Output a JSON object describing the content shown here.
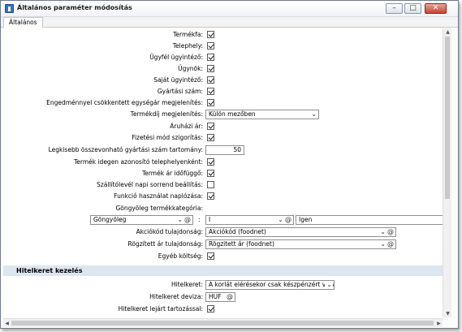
{
  "window": {
    "title": "Általános paraméter módosítás"
  },
  "tabs": [
    {
      "label": "Általános"
    }
  ],
  "params": {
    "termekfa": {
      "label": "Termékfa:",
      "checked": true
    },
    "telephely": {
      "label": "Telephely:",
      "checked": true
    },
    "ugyfel_ugyintezo": {
      "label": "Ügyfél ügyintéző:",
      "checked": true
    },
    "ugynok": {
      "label": "Ügynök:",
      "checked": true
    },
    "sajat_ugyintezo": {
      "label": "Saját ügyintéző:",
      "checked": true
    },
    "gyartasi_szam": {
      "label": "Gyártási szám:",
      "checked": true
    },
    "engedmeny": {
      "label": "Engedménnyel csökkentett egységár megjelenítés:",
      "checked": true
    },
    "termekdij": {
      "label": "Termékdíj megjelenítés:",
      "value": "Külön mezőben"
    },
    "aruhazi_ar": {
      "label": "Áruházi ár:",
      "checked": true
    },
    "fizetesi_mod": {
      "label": "Fizetési mód szigorítás:",
      "checked": true
    },
    "gyartasi_tartomany": {
      "label": "Legkisebb összevonható gyártási szám tartomány:",
      "value": "50"
    },
    "idegen_azonosito": {
      "label": "Termék idegen azonosító telephelyenként:",
      "checked": true
    },
    "ar_idofuggo": {
      "label": "Termék ár időfüggő:",
      "checked": true
    },
    "szallitolevel": {
      "label": "Szállítólevél napi sorrend beállítás:",
      "checked": false
    },
    "funkcio_naplozas": {
      "label": "Funkció használat naplózása:",
      "checked": true
    },
    "gongyoleg": {
      "label": "Göngyöleg termékkategória:",
      "kategoria": "Göngyöleg",
      "separator": ":",
      "kod": "I",
      "nev": "Igen"
    },
    "akciokod": {
      "label": "Akciókód tulajdonság:",
      "value": "Akciókód (foodnet)"
    },
    "rogzitett_ar": {
      "label": "Rögzített ár tulajdonság:",
      "value": "Rögzitett ár (foodnet)"
    },
    "egyeb_koltseg": {
      "label": "Egyéb költség:",
      "checked": true
    }
  },
  "hitelkeret": {
    "header": "Hitelkeret kezelés",
    "hitelkeret": {
      "label": "Hitelkeret:",
      "value": "A korlát elérésekor csak készpénzért vásárolhat"
    },
    "deviza": {
      "label": "Hitelkeret deviza:",
      "value": "HUF"
    },
    "lejart": {
      "label": "Hitelkeret lejárt tartozással:",
      "checked": true
    }
  },
  "icons": {
    "dropdown": "chevron-down-icon",
    "lookup": "at-sign-icon",
    "scroll_up": "scroll-up-arrow",
    "scroll_down": "scroll-down-arrow"
  }
}
